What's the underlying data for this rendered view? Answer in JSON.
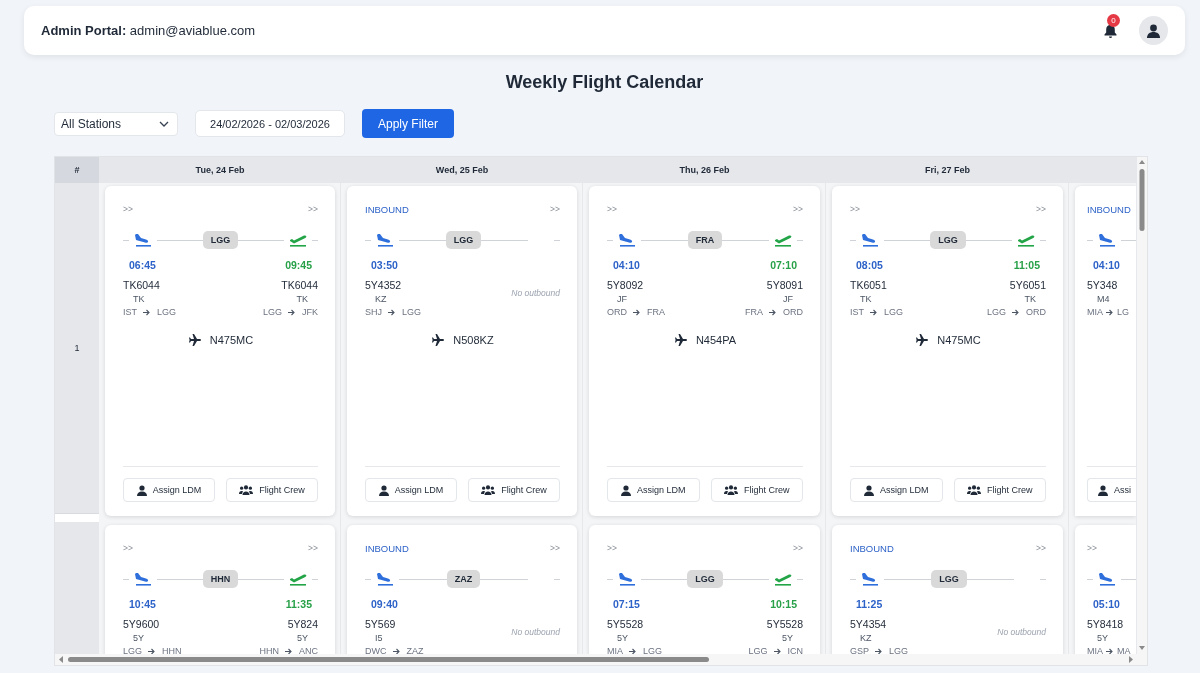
{
  "header": {
    "portal": "**Admin Portal:** admin@aviablue.com",
    "notifications": "0"
  },
  "title": "Weekly Flight Calendar",
  "filters": {
    "station": "All Stations",
    "date_range": "24/02/2026 - 02/03/2026",
    "apply": "Apply Filter"
  },
  "table": {
    "number_heading": "#",
    "columns": [
      "Tue, 24 Feb",
      "Wed, 25 Feb",
      "Thu, 26 Feb",
      "Fri, 27 Feb"
    ],
    "rows": [
      {
        "number": "1",
        "cards": [
          {
            "tag": {
              "kind": "arrows",
              "text": ">>"
            },
            "right_tag": ">>",
            "station": "LGG",
            "inbound": {
              "time": "06:45",
              "flight": "TK6044",
              "airline": "TK",
              "from": "IST",
              "to": "LGG"
            },
            "outbound": {
              "time": "09:45",
              "flight": "TK6044",
              "airline": "TK",
              "from": "LGG",
              "to": "JFK"
            },
            "aircraft": "N475MC",
            "buttons": [
              {
                "kind": "person",
                "label": "Assign LDM"
              },
              {
                "kind": "group",
                "label": "Flight Crew"
              }
            ]
          },
          {
            "tag": {
              "kind": "inbound",
              "text": "INBOUND"
            },
            "right_tag": ">>",
            "station": "LGG",
            "inbound": {
              "time": "03:50",
              "flight": "5Y4352",
              "airline": "KZ",
              "from": "SHJ",
              "to": "LGG"
            },
            "no_outbound": "No outbound",
            "aircraft": "N508KZ",
            "buttons": [
              {
                "kind": "person",
                "label": "Assign LDM"
              },
              {
                "kind": "group",
                "label": "Flight Crew"
              }
            ]
          },
          {
            "tag": {
              "kind": "arrows",
              "text": ">>"
            },
            "right_tag": ">>",
            "station": "FRA",
            "inbound": {
              "time": "04:10",
              "flight": "5Y8092",
              "airline": "JF",
              "from": "ORD",
              "to": "FRA"
            },
            "outbound": {
              "time": "07:10",
              "flight": "5Y8091",
              "airline": "JF",
              "from": "FRA",
              "to": "ORD"
            },
            "aircraft": "N454PA",
            "buttons": [
              {
                "kind": "person",
                "label": "Assign LDM"
              },
              {
                "kind": "group",
                "label": "Flight Crew"
              }
            ]
          },
          {
            "tag": {
              "kind": "arrows",
              "text": ">>"
            },
            "right_tag": ">>",
            "station": "LGG",
            "inbound": {
              "time": "08:05",
              "flight": "TK6051",
              "airline": "TK",
              "from": "IST",
              "to": "LGG"
            },
            "outbound": {
              "time": "11:05",
              "flight": "5Y6051",
              "airline": "TK",
              "from": "LGG",
              "to": "ORD"
            },
            "aircraft": "N475MC",
            "buttons": [
              {
                "kind": "person",
                "label": "Assign LDM"
              },
              {
                "kind": "group",
                "label": "Flight Crew"
              }
            ]
          },
          {
            "tag": {
              "kind": "inbound",
              "text": "INBOUND"
            },
            "inbound": {
              "time": "04:10",
              "flight": "5Y348",
              "airline": "M4",
              "from": "MIA",
              "to": "LG"
            },
            "buttons": [
              {
                "kind": "person",
                "label": "Assi"
              }
            ]
          }
        ]
      },
      {
        "number": "",
        "cards": [
          {
            "tag": {
              "kind": "arrows",
              "text": ">>"
            },
            "right_tag": ">>",
            "station": "HHN",
            "inbound": {
              "time": "10:45",
              "flight": "5Y9600",
              "airline": "5Y",
              "from": "LGG",
              "to": "HHN"
            },
            "outbound": {
              "time": "11:35",
              "flight": "5Y824",
              "airline": "5Y",
              "from": "HHN",
              "to": "ANC"
            }
          },
          {
            "tag": {
              "kind": "inbound",
              "text": "INBOUND"
            },
            "right_tag": ">>",
            "station": "ZAZ",
            "inbound": {
              "time": "09:40",
              "flight": "5Y569",
              "airline": "I5",
              "from": "DWC",
              "to": "ZAZ"
            },
            "no_outbound": "No outbound"
          },
          {
            "tag": {
              "kind": "arrows",
              "text": ">>"
            },
            "right_tag": ">>",
            "station": "LGG",
            "inbound": {
              "time": "07:15",
              "flight": "5Y5528",
              "airline": "5Y",
              "from": "MIA",
              "to": "LGG"
            },
            "outbound": {
              "time": "10:15",
              "flight": "5Y5528",
              "airline": "5Y",
              "from": "LGG",
              "to": "ICN"
            }
          },
          {
            "tag": {
              "kind": "inbound",
              "text": "INBOUND"
            },
            "right_tag": ">>",
            "station": "LGG",
            "inbound": {
              "time": "11:25",
              "flight": "5Y4354",
              "airline": "KZ",
              "from": "GSP",
              "to": "LGG"
            },
            "no_outbound": "No outbound"
          },
          {
            "tag": {
              "kind": "arrows",
              "text": ">>"
            },
            "inbound": {
              "time": "05:10",
              "flight": "5Y8418",
              "airline": "5Y",
              "from": "MIA",
              "to": "MA"
            }
          }
        ]
      }
    ]
  }
}
